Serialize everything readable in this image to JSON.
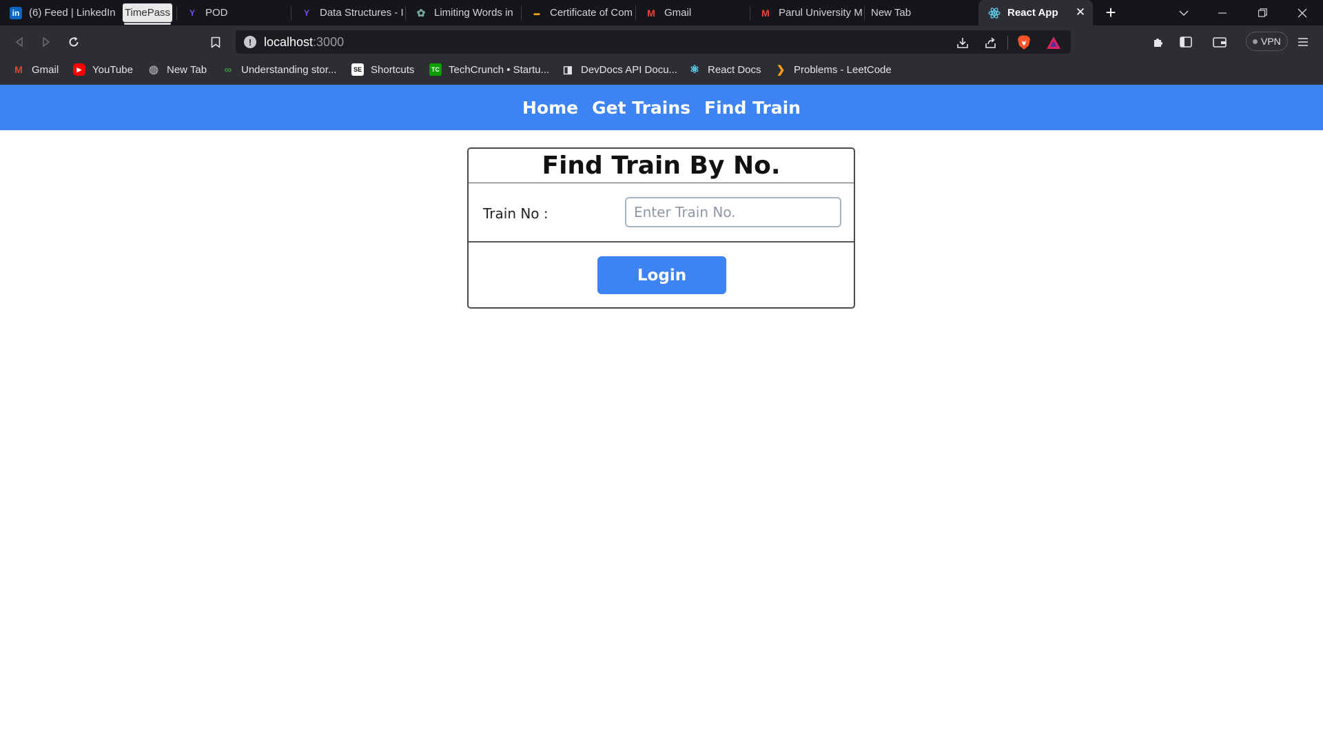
{
  "browser": {
    "tabs": [
      {
        "label": "(6) Feed | LinkedIn",
        "icon": "linkedin-icon",
        "icon_text": "in",
        "icon_color": "#0a66c2"
      },
      {
        "label": "POD",
        "icon": "pod-icon",
        "icon_text": "Y",
        "icon_color": "#7c4dff"
      },
      {
        "label": "Data Structures - I",
        "icon": "data-structures-icon",
        "icon_text": "Y",
        "icon_color": "#7c4dff"
      },
      {
        "label": "Limiting Words in",
        "icon": "chatgpt-icon",
        "icon_text": "✿",
        "icon_color": "#74aa9c"
      },
      {
        "label": "Certificate of Com",
        "icon": "certificate-icon",
        "icon_text": "▬",
        "icon_color": "#f59e0b"
      },
      {
        "label": "Gmail",
        "icon": "gmail-icon",
        "icon_text": "M",
        "icon_color": "#ea4335"
      },
      {
        "label": "Parul University M",
        "icon": "gmail-icon",
        "icon_text": "M",
        "icon_color": "#ea4335"
      },
      {
        "label": "New Tab",
        "icon": "",
        "icon_text": "",
        "icon_color": ""
      }
    ],
    "timepass_label": "TimePass",
    "active_tab": {
      "label": "React App",
      "icon": "react-icon",
      "close": "✕"
    },
    "new_tab_symbol": "+",
    "address": {
      "host": "localhost",
      "port": ":3000"
    },
    "vpn_label": "VPN",
    "bookmarks": [
      {
        "label": "Gmail",
        "icon": "gmail-icon",
        "icon_text": "M",
        "icon_color": "#ea4335"
      },
      {
        "label": "YouTube",
        "icon": "youtube-icon",
        "icon_text": "▶",
        "icon_color": "#ff0000"
      },
      {
        "label": "New Tab",
        "icon": "globe-icon",
        "icon_text": "◍",
        "icon_color": "#9a9ba0"
      },
      {
        "label": "Understanding stor...",
        "icon": "link-icon",
        "icon_text": "∞",
        "icon_color": "#3f9142"
      },
      {
        "label": "Shortcuts",
        "icon": "shortcuts-icon",
        "icon_text": "SE",
        "icon_color": "#ffffff"
      },
      {
        "label": "TechCrunch • Startu...",
        "icon": "techcrunch-icon",
        "icon_text": "TC",
        "icon_color": "#0a9e01"
      },
      {
        "label": "DevDocs API Docu...",
        "icon": "devdocs-icon",
        "icon_text": "◨",
        "icon_color": "#e4e5e7"
      },
      {
        "label": "React Docs",
        "icon": "react-icon",
        "icon_text": "⚛",
        "icon_color": "#61dafb"
      },
      {
        "label": "Problems - LeetCode",
        "icon": "leetcode-icon",
        "icon_text": "❯",
        "icon_color": "#ffa116"
      }
    ]
  },
  "nav": {
    "links": [
      "Home",
      "Get Trains",
      "Find Train"
    ]
  },
  "card": {
    "title": "Find Train By No.",
    "label": "Train No :",
    "placeholder": "Enter Train No.",
    "value": "",
    "button": "Login"
  },
  "colors": {
    "accent": "#3e83f3",
    "chrome_dark": "#151619",
    "chrome": "#2c2e33"
  }
}
